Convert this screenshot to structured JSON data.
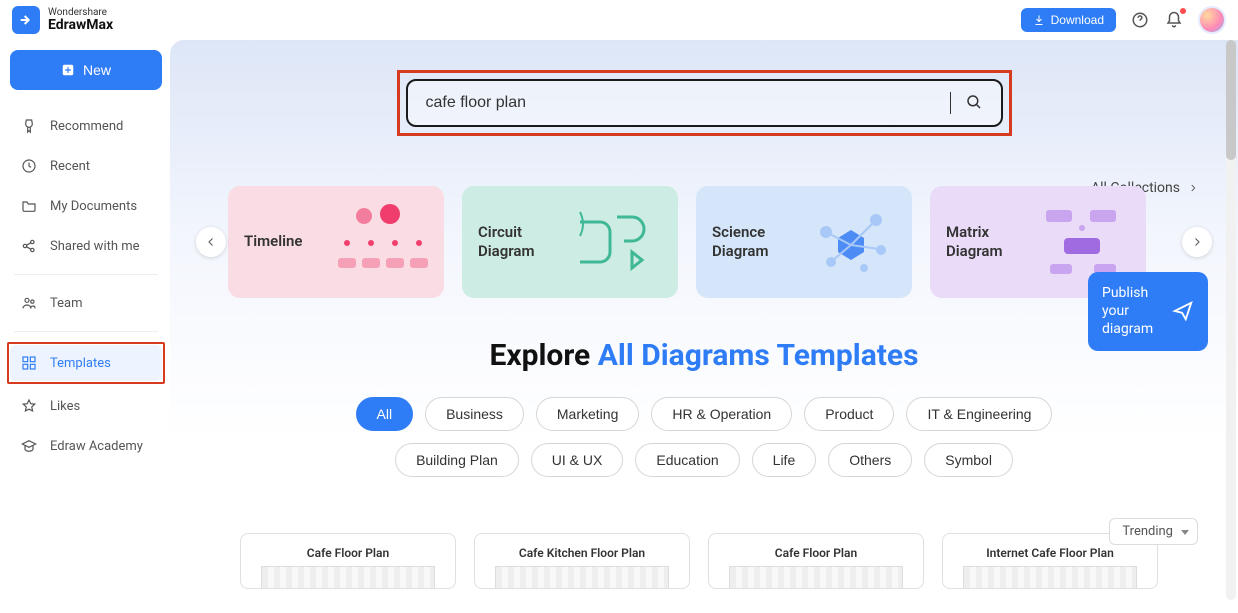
{
  "brand": {
    "top": "Wondershare",
    "bottom": "EdrawMax"
  },
  "topbar": {
    "download": "Download"
  },
  "sidebar": {
    "new": "New",
    "items": [
      {
        "label": "Recommend"
      },
      {
        "label": "Recent"
      },
      {
        "label": "My Documents"
      },
      {
        "label": "Shared with me"
      }
    ],
    "team": "Team",
    "templates": "Templates",
    "likes": "Likes",
    "academy": "Edraw Academy"
  },
  "search": {
    "value": "cafe floor plan"
  },
  "all_collections": "All Collections",
  "carousel": [
    {
      "label": "Timeline"
    },
    {
      "label": "Circuit Diagram"
    },
    {
      "label": "Science Diagram"
    },
    {
      "label": "Matrix Diagram"
    }
  ],
  "explore": {
    "prefix": "Explore ",
    "accent": "All Diagrams Templates"
  },
  "pills": [
    "All",
    "Business",
    "Marketing",
    "HR & Operation",
    "Product",
    "IT & Engineering",
    "Building Plan",
    "UI & UX",
    "Education",
    "Life",
    "Others",
    "Symbol"
  ],
  "sort": "Trending",
  "results": [
    {
      "title": "Cafe Floor Plan"
    },
    {
      "title": "Cafe Kitchen Floor Plan"
    },
    {
      "title": "Cafe Floor Plan"
    },
    {
      "title": "Internet Cafe Floor Plan"
    }
  ],
  "publish": "Publish your diagram"
}
